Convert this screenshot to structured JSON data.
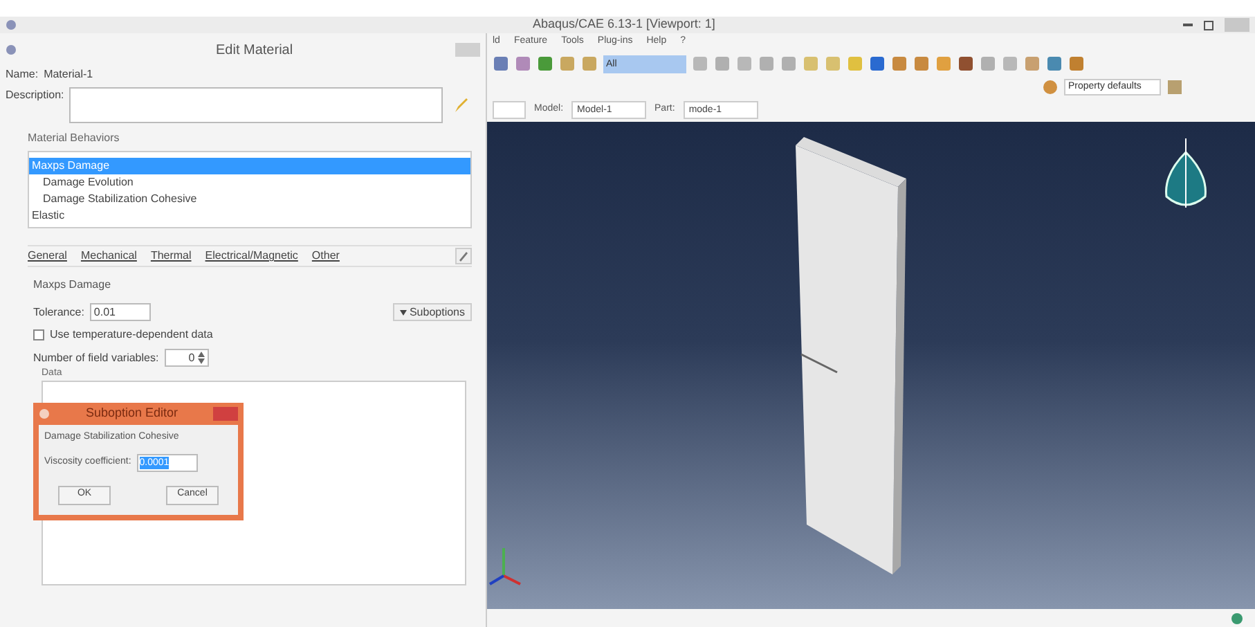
{
  "app_window": {
    "title": "Abaqus/CAE 6.13-1 [Viewport: 1]"
  },
  "menu_bar": [
    "ld",
    "Feature",
    "Tools",
    "Plug-ins",
    "Help",
    "?"
  ],
  "toolbar": {
    "filter_value": "All",
    "defaults_value": "Property defaults"
  },
  "context_bar": {
    "model_label": "Model:",
    "model_value": "Model-1",
    "part_label": "Part:",
    "part_value": "mode-1"
  },
  "edit_material": {
    "title": "Edit Material",
    "name_label": "Name:",
    "name_value": "Material-1",
    "description_label": "Description:",
    "behaviors_label": "Material Behaviors",
    "behaviors": [
      {
        "label": "Maxps Damage",
        "selected": true,
        "children": [
          {
            "label": "Damage Evolution",
            "selected": false
          },
          {
            "label": "Damage Stabilization Cohesive",
            "selected": false
          }
        ]
      },
      {
        "label": "Elastic",
        "selected": false
      }
    ],
    "menus": [
      "General",
      "Mechanical",
      "Thermal",
      "Electrical/Magnetic",
      "Other"
    ],
    "section_title": "Maxps Damage",
    "tolerance_label": "Tolerance:",
    "tolerance_value": "0.01",
    "suboptions_button": "Suboptions",
    "temperature_checkbox": {
      "label": "Use temperature-dependent data",
      "checked": false
    },
    "field_variables_label": "Number of field variables:",
    "field_variables_value": "0",
    "data_label": "Data"
  },
  "suboption_editor": {
    "title": "Suboption Editor",
    "heading": "Damage Stabilization Cohesive",
    "viscosity_label": "Viscosity coefficient:",
    "viscosity_value": "0.0001",
    "buttons": [
      "OK",
      "Cancel"
    ]
  }
}
